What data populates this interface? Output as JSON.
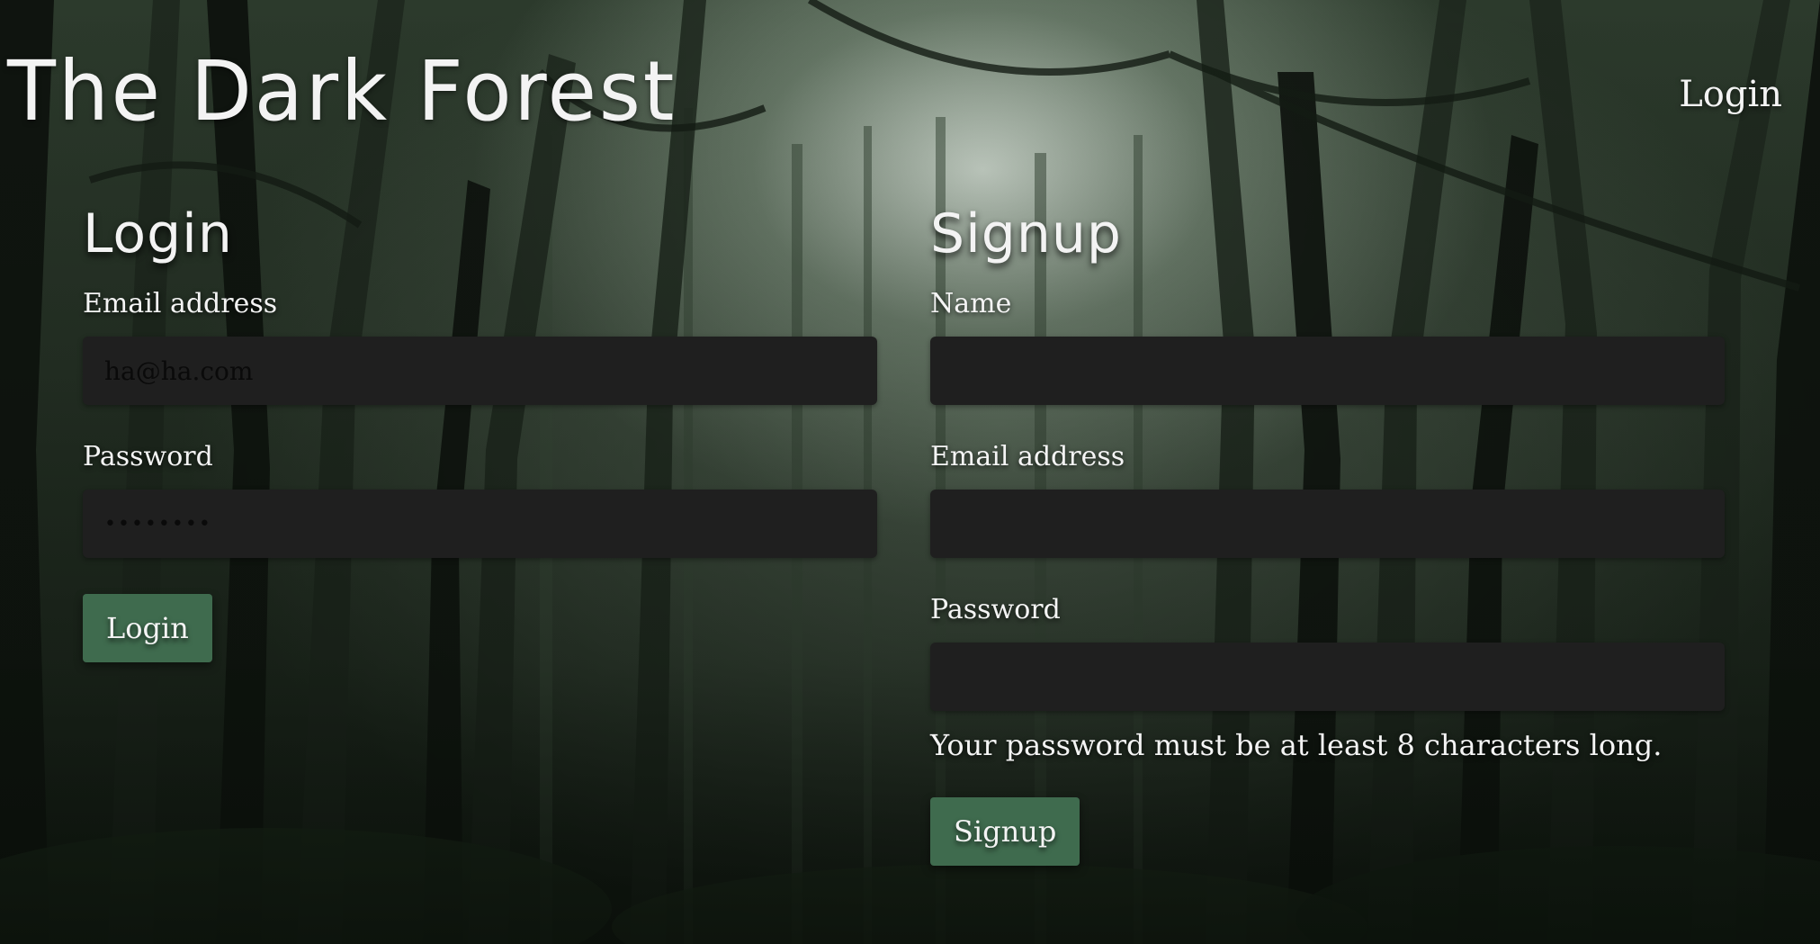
{
  "header": {
    "title": "The Dark Forest",
    "nav_login": "Login"
  },
  "login": {
    "title": "Login",
    "email_label": "Email address",
    "email_value": "ha@ha.com",
    "password_label": "Password",
    "password_value": "••••••••",
    "button_label": "Login"
  },
  "signup": {
    "title": "Signup",
    "name_label": "Name",
    "name_value": "",
    "email_label": "Email address",
    "email_value": "",
    "password_label": "Password",
    "password_value": "",
    "help_text": "Your password must be at least 8 characters long.",
    "button_label": "Signup"
  },
  "colors": {
    "button_bg": "#3f6b4e",
    "input_bg": "#1f1f1f",
    "text": "#f4f4f4"
  }
}
